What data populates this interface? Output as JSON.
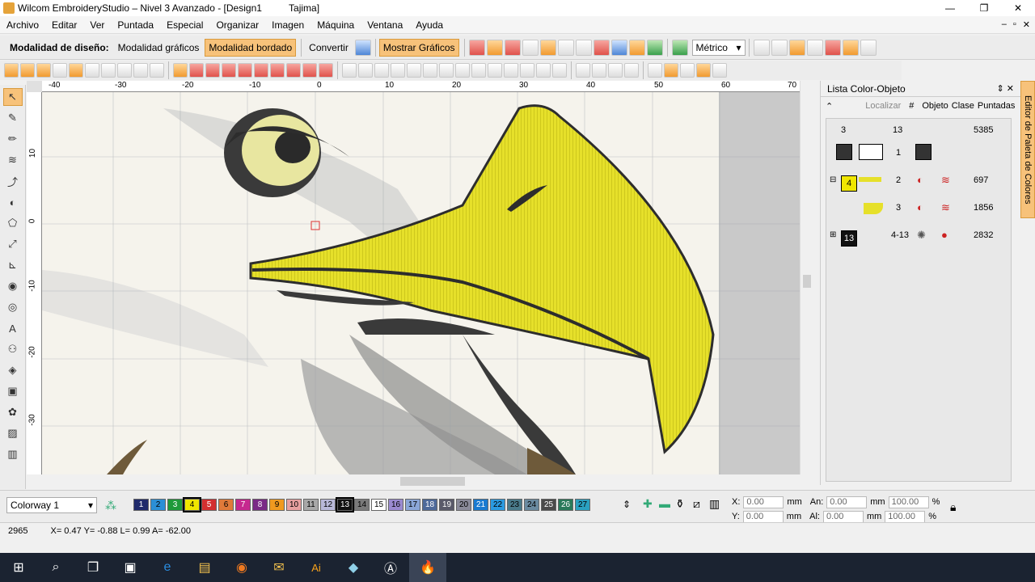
{
  "window": {
    "title": "Wilcom EmbroideryStudio – Nivel 3 Avanzado - [Design1          Tajima]",
    "minimize": "—",
    "restore": "❐",
    "close": "✕"
  },
  "menu": {
    "items": [
      "Archivo",
      "Editar",
      "Ver",
      "Puntada",
      "Especial",
      "Organizar",
      "Imagen",
      "Máquina",
      "Ventana",
      "Ayuda"
    ],
    "mdi": [
      "–",
      "▫",
      "✕"
    ]
  },
  "toolbar": {
    "mode_label": "Modalidad de diseño:",
    "graphics_mode": "Modalidad gráficos",
    "embroidery_mode": "Modalidad bordado",
    "convert": "Convertir",
    "show_graphics": "Mostrar Gráficos",
    "units": "Métrico"
  },
  "ruler": {
    "h_labels": [
      "-40",
      "-30",
      "-20",
      "-10",
      "0",
      "10",
      "20",
      "30",
      "40",
      "50",
      "60",
      "70"
    ],
    "v_labels": [
      "10",
      "0",
      "-10",
      "-20",
      "-30"
    ]
  },
  "panel": {
    "title": "Lista Color-Objeto",
    "pin": "⇕ ✕",
    "locate": "Localizar",
    "headers": [
      "#",
      "Objeto",
      "Clase",
      "Puntadas"
    ],
    "summary": {
      "colors": "3",
      "objects": "13",
      "stitches": "5385"
    },
    "rows": [
      {
        "num": "1",
        "swatch": "",
        "stitches": ""
      },
      {
        "num": "2",
        "swatch": "4",
        "stitches": "697"
      },
      {
        "num": "3",
        "swatch": "",
        "stitches": "1856"
      },
      {
        "num": "4-13",
        "swatch": "13",
        "stitches": "2832"
      }
    ],
    "side_tab": "Editor de Paleta de Colores"
  },
  "colorway": {
    "value": "Colorway 1"
  },
  "palette": [
    {
      "n": "1",
      "c": "#1f2a6b"
    },
    {
      "n": "2",
      "c": "#2b8fd6"
    },
    {
      "n": "3",
      "c": "#1f9a3a"
    },
    {
      "n": "4",
      "c": "#f0e600"
    },
    {
      "n": "5",
      "c": "#d32f2f"
    },
    {
      "n": "6",
      "c": "#e07a3a"
    },
    {
      "n": "7",
      "c": "#c6288f"
    },
    {
      "n": "8",
      "c": "#7a2a86"
    },
    {
      "n": "9",
      "c": "#f09a20"
    },
    {
      "n": "10",
      "c": "#e8a0a0"
    },
    {
      "n": "11",
      "c": "#a8a8a8"
    },
    {
      "n": "12",
      "c": "#b8b8d8"
    },
    {
      "n": "13",
      "c": "#111111"
    },
    {
      "n": "14",
      "c": "#7a7a7a"
    },
    {
      "n": "15",
      "c": "#ffffff"
    },
    {
      "n": "16",
      "c": "#9a8ad0"
    },
    {
      "n": "17",
      "c": "#8aa6d8"
    },
    {
      "n": "18",
      "c": "#4e6a9a"
    },
    {
      "n": "19",
      "c": "#5a5a6a"
    },
    {
      "n": "20",
      "c": "#8a8a9a"
    },
    {
      "n": "21",
      "c": "#1a7ad0"
    },
    {
      "n": "22",
      "c": "#2a9ae0"
    },
    {
      "n": "23",
      "c": "#4a7a8a"
    },
    {
      "n": "24",
      "c": "#6a8aa0"
    },
    {
      "n": "25",
      "c": "#4a4a4a"
    },
    {
      "n": "26",
      "c": "#2a7a5a"
    },
    {
      "n": "27",
      "c": "#2aa0c0"
    }
  ],
  "coords": {
    "x_label": "X:",
    "x": "0.00",
    "y_label": "Y:",
    "y": "0.00",
    "mm": "mm",
    "w_label": "An:",
    "w": "0.00",
    "h_label": "Al:",
    "h": "0.00",
    "pct": "100.00",
    "pct_sym": "%"
  },
  "status": {
    "stitch": "2965",
    "readout": "X=  0.47 Y=  -0.88 L=  0.99 A= -62.00"
  },
  "taskbar": [
    "⊞",
    "⌕",
    "❐",
    "▣",
    "e",
    "▤",
    "◉",
    "✉",
    "Ai",
    "◆",
    "Ⓐ",
    "🔥"
  ]
}
